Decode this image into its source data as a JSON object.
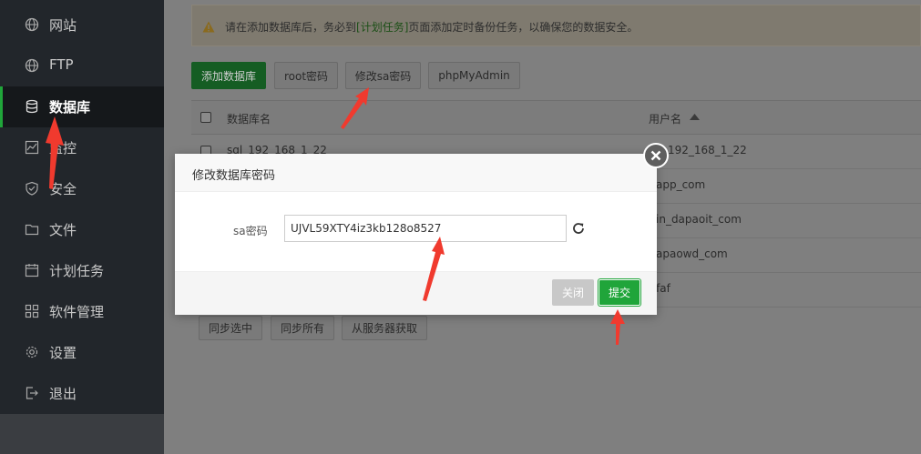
{
  "sidebar": {
    "items": [
      {
        "label": "网站",
        "icon": "globe-icon"
      },
      {
        "label": "FTP",
        "icon": "globe-icon"
      },
      {
        "label": "数据库",
        "icon": "database-icon"
      },
      {
        "label": "监控",
        "icon": "monitor-icon"
      },
      {
        "label": "安全",
        "icon": "shield-icon"
      },
      {
        "label": "文件",
        "icon": "folder-icon"
      },
      {
        "label": "计划任务",
        "icon": "calendar-icon"
      },
      {
        "label": "软件管理",
        "icon": "grid-icon"
      },
      {
        "label": "设置",
        "icon": "gear-icon"
      },
      {
        "label": "退出",
        "icon": "logout-icon"
      }
    ],
    "active_index": 2
  },
  "alert": {
    "prefix": "请在添加数据库后，务必到",
    "link": "[计划任务]",
    "suffix": "页面添加定时备份任务，以确保您的数据安全。"
  },
  "toolbar": {
    "add": "添加数据库",
    "root_password": "root密码",
    "change_sa": "修改sa密码",
    "phpmyadmin": "phpMyAdmin"
  },
  "table": {
    "headers": {
      "name": "数据库名",
      "user": "用户名"
    },
    "rows": [
      {
        "name": "sql_192_168_1_22",
        "user": "192_168_1_22"
      },
      {
        "name": "",
        "user": "app_com"
      },
      {
        "name": "",
        "user": "in_dapaoit_com"
      },
      {
        "name": "",
        "user": "apaowd_com"
      },
      {
        "name": "",
        "user": "faf"
      }
    ]
  },
  "footer_buttons": {
    "sync_selected": "同步选中",
    "sync_all": "同步所有",
    "fetch_from_server": "从服务器获取"
  },
  "modal": {
    "title": "修改数据库密码",
    "field_label": "sa密码",
    "field_value": "UJVL59XTY4iz3kb128o8527",
    "close_label": "关闭",
    "submit_label": "提交"
  },
  "colors": {
    "accent": "#20a53a",
    "annotation": "#f03a2e",
    "sidebar": "#22262b"
  }
}
